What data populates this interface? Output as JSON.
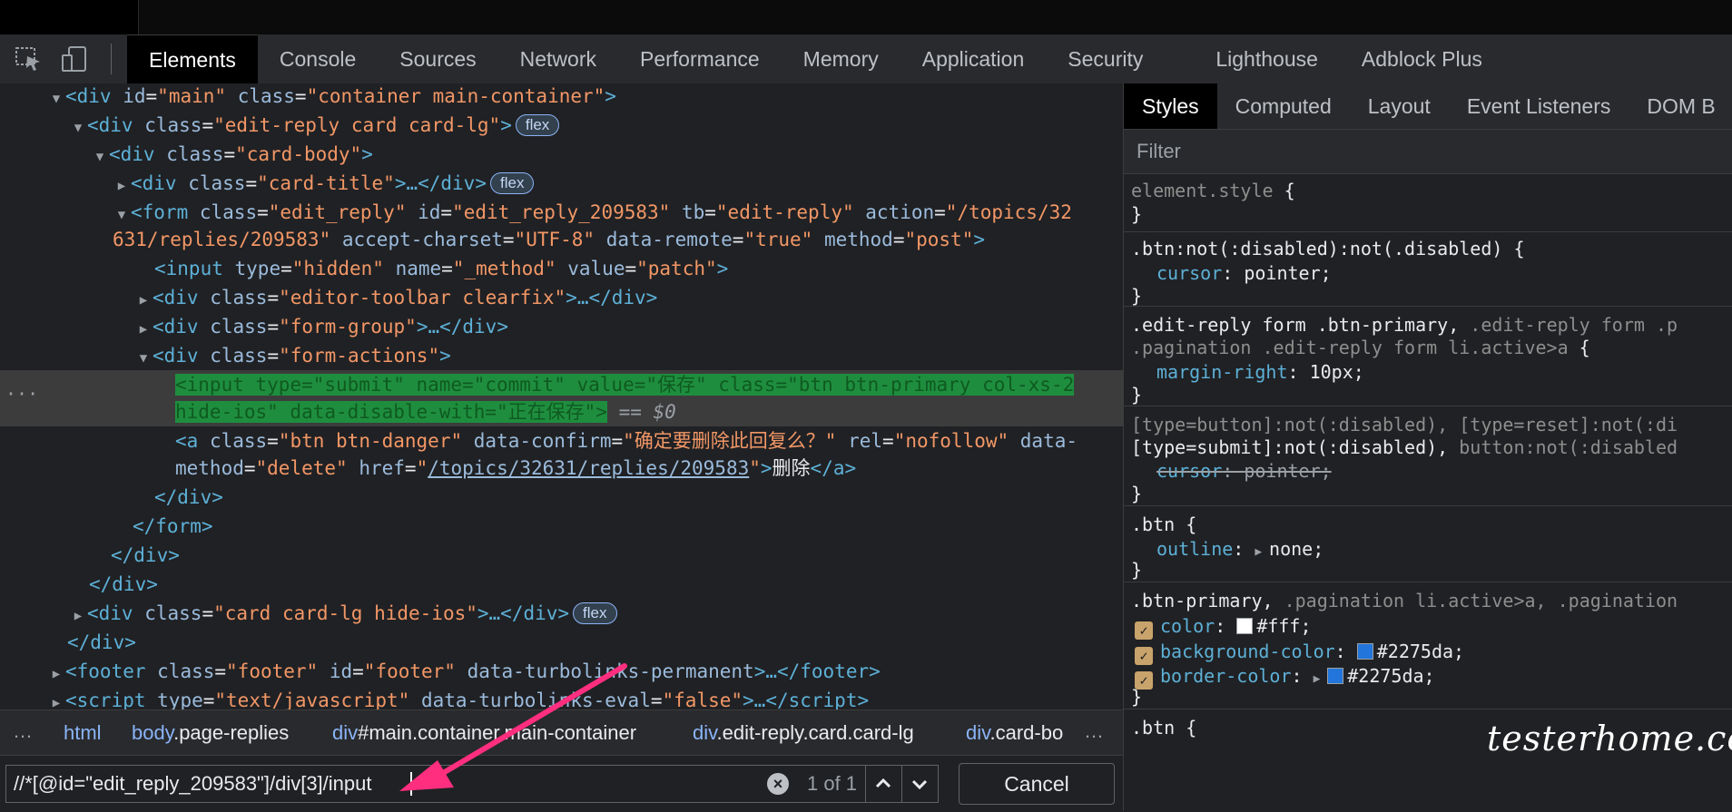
{
  "toolbar": {
    "tabs": [
      "Elements",
      "Console",
      "Sources",
      "Network",
      "Performance",
      "Memory",
      "Application",
      "Security",
      "Lighthouse",
      "Adblock Plus"
    ]
  },
  "dom": {
    "l1": {
      "tag": "div",
      "id_attr": "id",
      "id_val": "\"main\"",
      "class_attr": "class",
      "class_val": "\"container main-container\""
    },
    "l2": {
      "open": "<div",
      "cls": "class",
      "val": "\"edit-reply card card-lg\"",
      "badge": "flex"
    },
    "l3": {
      "open": "<div",
      "cls": "class",
      "val": "\"card-body\""
    },
    "l4": {
      "open": "<div",
      "cls": "class",
      "val": "\"card-title\"",
      "rest": ">…</div>",
      "badge": "flex"
    },
    "l5": {
      "open": "<form",
      "a1": "class",
      "v1": "\"edit_reply\"",
      "a2": "id",
      "v2": "\"edit_reply_209583\"",
      "a3": "tb",
      "v3": "\"edit-reply\"",
      "a4": "action",
      "v4": "\"/topics/32"
    },
    "l5b": {
      "v": "631/replies/209583\"",
      "a1": "accept-charset",
      "v1": "\"UTF-8\"",
      "a2": "data-remote",
      "v2": "\"true\"",
      "a3": "method",
      "v3": "\"post\""
    },
    "l6": {
      "a1": "type",
      "v1": "\"hidden\"",
      "a2": "name",
      "v2": "\"_method\"",
      "a3": "value",
      "v3": "\"patch\""
    },
    "l7": {
      "val": "\"editor-toolbar clearfix\""
    },
    "l8": {
      "val": "\"form-group\""
    },
    "l9": {
      "val": "\"form-actions\""
    },
    "sel1": "<input type=\"submit\" name=\"commit\" value=\"保存\" class=\"btn btn-primary col-xs-2",
    "sel2": "hide-ios\" data-disable-with=\"正在保存\">",
    "sel_eq": "== $0",
    "a1": {
      "a1": "class",
      "v1": "\"btn btn-danger\"",
      "a2": "data-confirm",
      "v2": "\"确定要删除此回复么？\"",
      "a3": "rel",
      "v3": "\"nofollow\"",
      "a4": "data-"
    },
    "a2": {
      "a1": "method",
      "v1": "\"delete\"",
      "a2": "href",
      "v2": "\"",
      "link": "/topics/32631/replies/209583",
      "q": "\"",
      "text": "删除"
    },
    "close_div": "</div>",
    "close_form": "</form>",
    "cardlg": {
      "val": "\"card card-lg hide-ios\"",
      "badge": "flex"
    },
    "footer": {
      "a1": "class",
      "v1": "\"footer\"",
      "a2": "id",
      "v2": "\"footer\"",
      "a3": "data-turbolinks-permanent"
    },
    "script": {
      "a1": "type",
      "v1": "\"text/javascript\"",
      "a2": "data-turbolinks-eval",
      "v2": "\"false\""
    }
  },
  "breadcrumbs": [
    {
      "blue": "html",
      "white": ""
    },
    {
      "blue": "body",
      "white": ".page-replies"
    },
    {
      "blue": "div",
      "white": "#main.container.main-container"
    },
    {
      "blue": "div",
      "white": ".edit-reply.card.card-lg"
    },
    {
      "blue": "div",
      "white": ".card-bo"
    }
  ],
  "search": {
    "value": "//*[@id=\"edit_reply_209583\"]/div[3]/input",
    "match": "1 of 1",
    "cancel": "Cancel"
  },
  "styles": {
    "tabs": [
      "Styles",
      "Computed",
      "Layout",
      "Event Listeners",
      "DOM B"
    ],
    "filter": "Filter",
    "r1": {
      "sel": "element.style"
    },
    "r2": {
      "sel": ".btn:not(:disabled):not(.disabled)",
      "prop": "cursor",
      "val": "pointer;"
    },
    "r3": {
      "sel": ".edit-reply form .btn-primary,",
      "sel_dim": " .edit-reply form .p",
      "sel2": ".pagination .edit-reply form li.active>a",
      "prop": "margin-right",
      "val": "10px;"
    },
    "r4": {
      "sel_dim": "[type=button]:not(:disabled), [type=reset]:not(:di",
      "sel2": "[type=submit]:not(:disabled),",
      "sel2_dim": " button:not(:disabled",
      "prop": "cursor",
      "val": "pointer;"
    },
    "r5": {
      "sel": ".btn",
      "prop": "outline",
      "val": "none;"
    },
    "r6": {
      "sel": ".btn-primary,",
      "sel_dim": " .pagination li.active>a, .pagination",
      "p1": "color",
      "v1": "#fff;",
      "p2": "background-color",
      "v2": "#2275da;",
      "p3": "border-color",
      "v3": "#2275da;"
    },
    "r7": {
      "sel": ".btn {"
    }
  },
  "watermark": "testerhome.com",
  "colors": {
    "accent": "#2275da",
    "white": "#ffffff",
    "selection": "#1e8e3e"
  }
}
